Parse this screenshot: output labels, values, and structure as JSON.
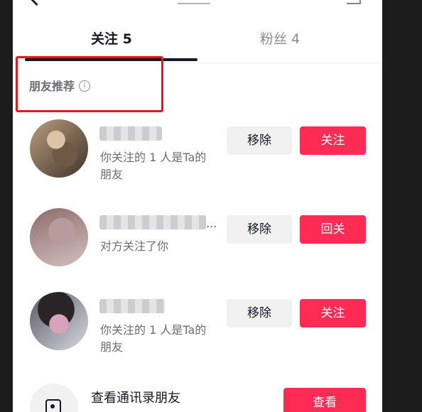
{
  "tabs": {
    "following": "关注 5",
    "fans": "粉丝 4"
  },
  "section": {
    "label": "朋友推荐",
    "info_glyph": "i"
  },
  "rows": [
    {
      "subtitle": "你关注的 1 人是Ta的朋友",
      "remove_label": "移除",
      "action_label": "关注"
    },
    {
      "name_ellipsis": "...",
      "subtitle": "对方关注了你",
      "remove_label": "移除",
      "action_label": "回关"
    },
    {
      "subtitle": "你关注的 1 人是Ta的朋友",
      "remove_label": "移除",
      "action_label": "关注"
    }
  ],
  "contacts": {
    "label": "查看通讯录朋友",
    "button_label": "查看"
  },
  "colors": {
    "accent": "#fe2c55",
    "highlight": "#e8171d",
    "text_primary": "#161823",
    "text_secondary": "#6b6c72",
    "button_gray": "#f1f1f2"
  }
}
